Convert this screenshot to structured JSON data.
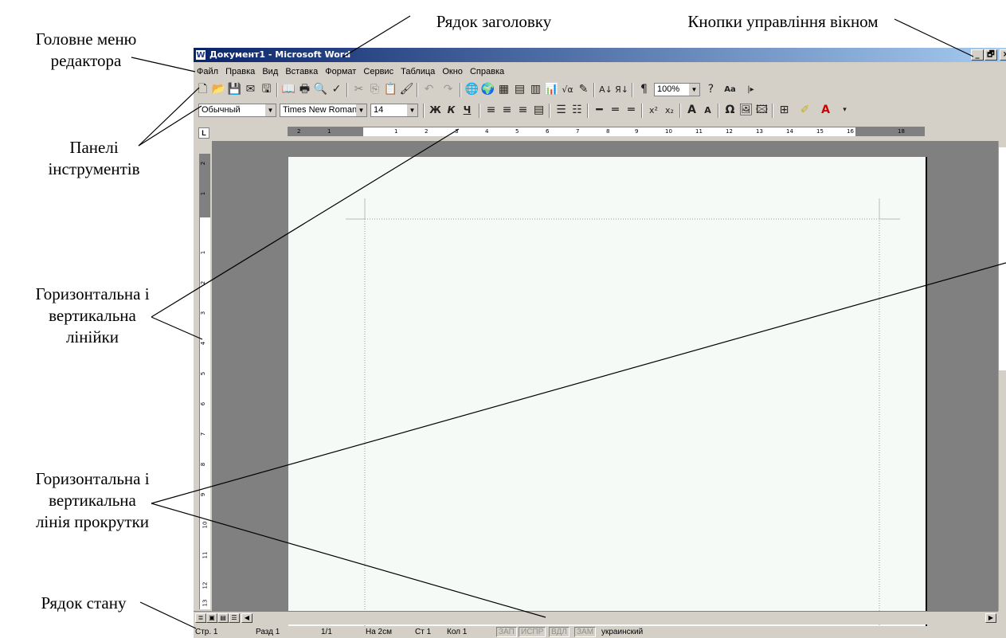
{
  "annotations": {
    "main_menu": "Головне меню\nредактора",
    "title_bar": "Рядок заголовку",
    "window_buttons": "Кнопки управління вікном",
    "toolbars": "Панелі\nінструментів",
    "rulers": "Горизонтальна і\nвертикальна\nлінійки",
    "scrollbars": "Горизонтальна і\nвертикальна\nлінія прокрутки",
    "status_bar": "Рядок стану"
  },
  "window": {
    "title": "Документ1 - Microsoft Word",
    "app_icon": "W",
    "controls": {
      "minimize": "_",
      "restore": "🗗",
      "close": "×"
    }
  },
  "menu": [
    "Файл",
    "Правка",
    "Вид",
    "Вставка",
    "Формат",
    "Сервис",
    "Таблица",
    "Окно",
    "Справка"
  ],
  "formatting": {
    "style": "Обычный",
    "font": "Times New Roman",
    "size": "14",
    "zoom": "100%",
    "bold": "Ж",
    "italic": "К",
    "underline": "Ч"
  },
  "ruler_numbers": {
    "horizontal": [
      "2",
      "1",
      "1",
      "2",
      "3",
      "4",
      "5",
      "6",
      "7",
      "8",
      "9",
      "10",
      "11",
      "12",
      "13",
      "14",
      "15",
      "16",
      "18"
    ],
    "vertical": [
      "2",
      "1",
      "1",
      "2",
      "3",
      "4",
      "5",
      "6",
      "7",
      "8",
      "9",
      "10",
      "11",
      "12",
      "13"
    ]
  },
  "status": {
    "page": "Стр. 1",
    "section": "Разд 1",
    "pages": "1/1",
    "at": "На 2см",
    "line": "Ст 1",
    "col": "Кол 1",
    "rec": "ЗАП",
    "trk": "ИСПР",
    "ext": "ВДЛ",
    "ovr": "ЗАМ",
    "lang": "украинский"
  }
}
